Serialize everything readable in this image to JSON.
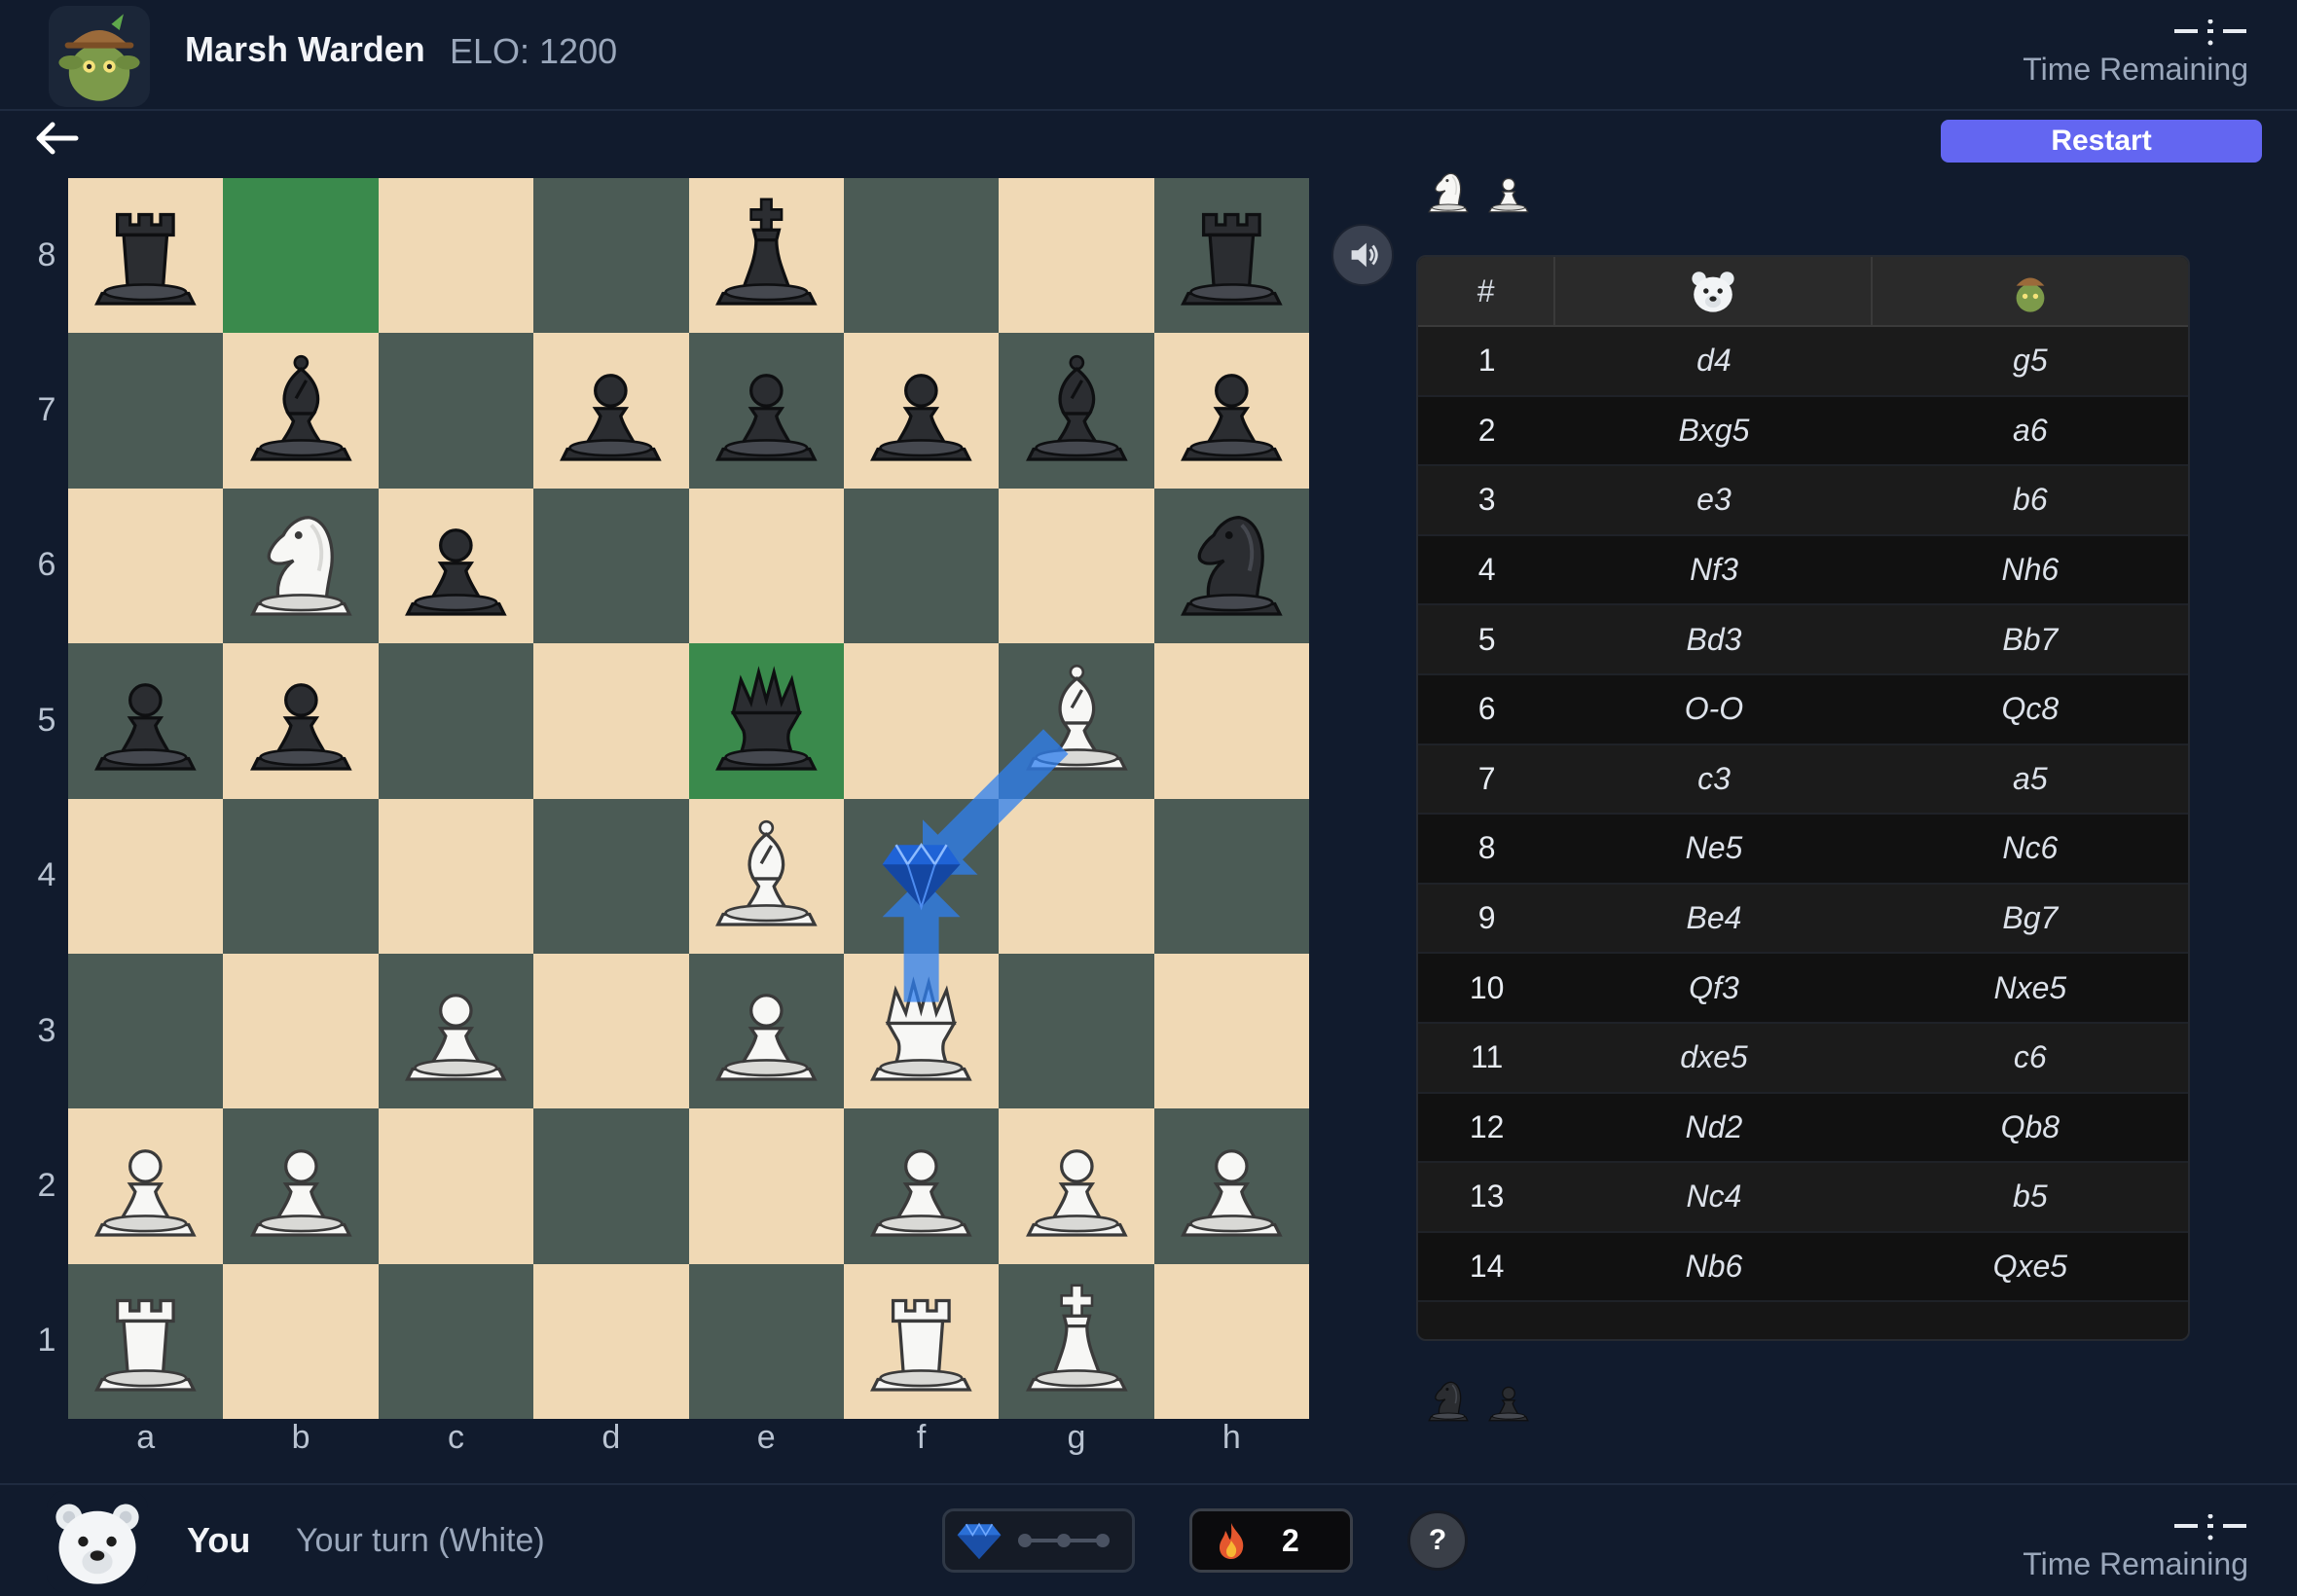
{
  "opponent": {
    "name": "Marsh Warden",
    "elo": "ELO: 1200",
    "timer_label": "Time Remaining",
    "avatar": "goblin-with-hat"
  },
  "player": {
    "name": "You",
    "status": "Your turn (White)",
    "timer_label": "Time Remaining",
    "avatar": "polar-bear"
  },
  "toolbar": {
    "restart_label": "Restart",
    "back_icon": "arrow-left-icon",
    "sound_icon": "speaker-icon"
  },
  "board": {
    "files": [
      "a",
      "b",
      "c",
      "d",
      "e",
      "f",
      "g",
      "h"
    ],
    "ranks": [
      "8",
      "7",
      "6",
      "5",
      "4",
      "3",
      "2",
      "1"
    ],
    "position": [
      [
        "bR",
        "",
        "",
        "",
        "bK",
        "",
        "",
        "bR"
      ],
      [
        "",
        "bB",
        "",
        "bP",
        "bP",
        "bP",
        "bB",
        "bP"
      ],
      [
        "",
        "wN",
        "bP",
        "",
        "",
        "",
        "",
        "bN"
      ],
      [
        "bP",
        "bP",
        "",
        "",
        "bQ",
        "",
        "wB",
        ""
      ],
      [
        "",
        "",
        "",
        "",
        "wB",
        "",
        "",
        ""
      ],
      [
        "",
        "",
        "wP",
        "",
        "wP",
        "wQ",
        "",
        ""
      ],
      [
        "wP",
        "wP",
        "",
        "",
        "",
        "wP",
        "wP",
        "wP"
      ],
      [
        "wR",
        "",
        "",
        "",
        "",
        "wR",
        "wK",
        ""
      ]
    ],
    "highlighted_squares": [
      "b8",
      "e5"
    ],
    "hint_arrows": [
      {
        "from": "g5",
        "to": "f4"
      },
      {
        "from": "f3",
        "to": "f4"
      }
    ],
    "hint_marker": {
      "square": "f4",
      "icon": "gem-icon"
    },
    "colors": {
      "light": "#f0d9b5",
      "dark": "#4b5b55",
      "highlight": "#3a8a4c",
      "arrow": "#2d7ff0"
    }
  },
  "captured": {
    "by_player": [
      "white-knight",
      "white-pawn"
    ],
    "by_opponent": [
      "black-knight",
      "black-pawn"
    ]
  },
  "moves": {
    "header_num": "#",
    "rows": [
      {
        "num": "1",
        "white": "d4",
        "black": "g5"
      },
      {
        "num": "2",
        "white": "Bxg5",
        "black": "a6"
      },
      {
        "num": "3",
        "white": "e3",
        "black": "b6"
      },
      {
        "num": "4",
        "white": "Nf3",
        "black": "Nh6"
      },
      {
        "num": "5",
        "white": "Bd3",
        "black": "Bb7"
      },
      {
        "num": "6",
        "white": "O-O",
        "black": "Qc8"
      },
      {
        "num": "7",
        "white": "c3",
        "black": "a5"
      },
      {
        "num": "8",
        "white": "Ne5",
        "black": "Nc6"
      },
      {
        "num": "9",
        "white": "Be4",
        "black": "Bg7"
      },
      {
        "num": "10",
        "white": "Qf3",
        "black": "Nxe5"
      },
      {
        "num": "11",
        "white": "dxe5",
        "black": "c6"
      },
      {
        "num": "12",
        "white": "Nd2",
        "black": "Qb8"
      },
      {
        "num": "13",
        "white": "Nc4",
        "black": "b5"
      },
      {
        "num": "14",
        "white": "Nb6",
        "black": "Qxe5"
      }
    ]
  },
  "widgets": {
    "gem_icon": "gem-icon",
    "fire_icon": "fire-icon",
    "fire_count": "2",
    "help_label": "?"
  }
}
